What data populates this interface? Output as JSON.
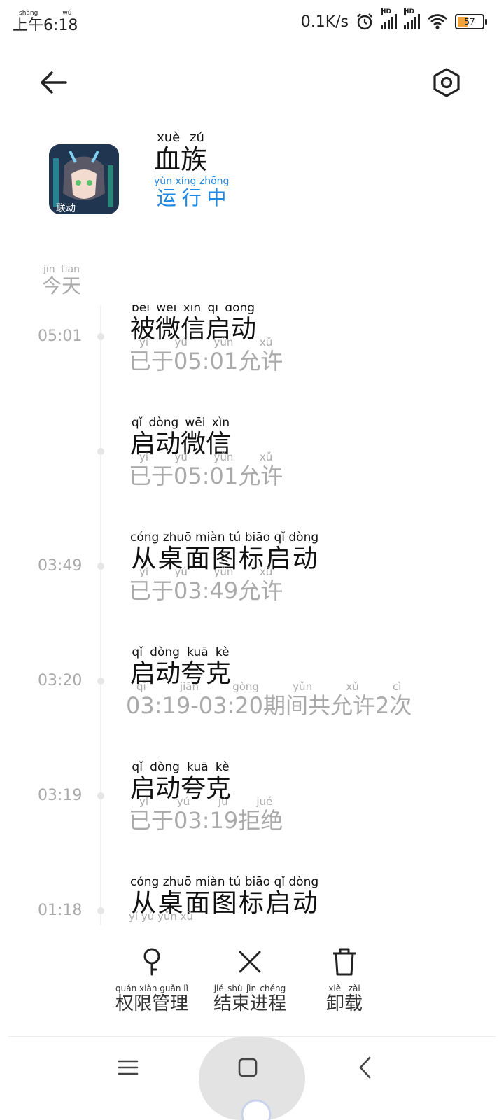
{
  "status_bar": {
    "time": "上午6:18",
    "time_ruby": "shàng wǔ",
    "net_speed": "0.1K/s",
    "battery": "57",
    "signal_label": "HD"
  },
  "header": {
    "back_icon": "arrow-left-icon",
    "settings_icon": "settings-icon"
  },
  "app": {
    "name": "血族",
    "name_ruby": "xuè zú",
    "status": "运行中",
    "status_ruby": "yùn xíng zhōng"
  },
  "timeline": {
    "day_label": "今天",
    "day_label_ruby": "jīn tiān",
    "entries": [
      {
        "time": "05:01",
        "title": "被微信启动",
        "title_ruby": "bèi wēi xìn qǐ dòng",
        "sub": "已于05:01允许",
        "sub_ruby": "yǐ yú yǔn xǔ"
      },
      {
        "time": "",
        "title": "启动微信",
        "title_ruby": "qǐ dòng wēi xìn",
        "sub": "已于05:01允许",
        "sub_ruby": "yǐ yú yǔn xǔ"
      },
      {
        "time": "03:49",
        "title": "从桌面图标启动",
        "title_ruby": "cóng zhuō miàn tú biāo qǐ dòng",
        "sub": "已于03:49允许",
        "sub_ruby": "yǐ yú yǔn xǔ"
      },
      {
        "time": "03:20",
        "title": "启动夸克",
        "title_ruby": "qǐ dòng kuā kè",
        "sub": "03:19-03:20期间共允许2次",
        "sub_ruby": "qī jiān gòng yǔn xǔ cì"
      },
      {
        "time": "03:19",
        "title": "启动夸克",
        "title_ruby": "qǐ dòng kuā kè",
        "sub": "已于03:19拒绝",
        "sub_ruby": "yǐ yú jù jué"
      },
      {
        "time": "01:18",
        "title": "从桌面图标启动",
        "title_ruby": "cóng zhuō miàn tú biāo qǐ dòng",
        "sub": "",
        "sub_ruby": "yǐ yú yǔn xǔ"
      }
    ]
  },
  "actions": {
    "permissions": {
      "label": "权限管理",
      "ruby": "quán xiàn guǎn lǐ",
      "icon": "key-icon"
    },
    "stop": {
      "label": "结束进程",
      "ruby": "jié shù jìn chéng",
      "icon": "close-icon"
    },
    "uninstall": {
      "label": "卸载",
      "ruby": "xiè zài",
      "icon": "trash-icon"
    }
  },
  "navbar": {
    "menu_icon": "menu-icon",
    "home_icon": "home-square-icon",
    "back_icon": "chevron-left-icon"
  },
  "colors": {
    "accent": "#1e88e5",
    "muted": "#aaaaaa",
    "battery_fill": "#f2a23a"
  }
}
